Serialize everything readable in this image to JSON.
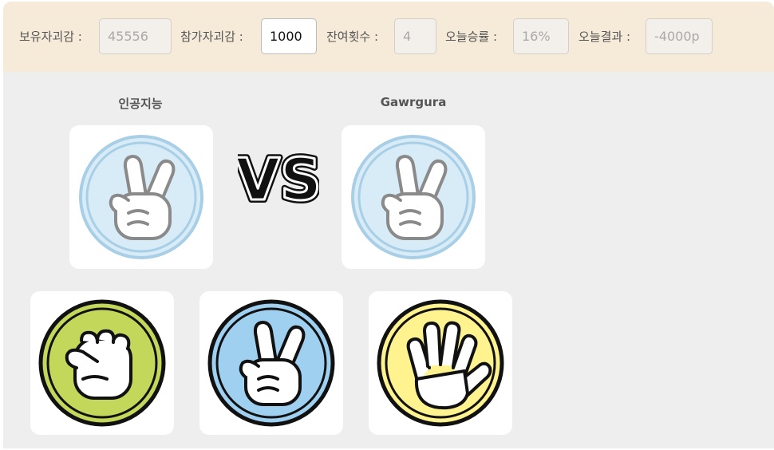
{
  "topbar": {
    "fields": [
      {
        "label": "보유자괴감 :",
        "value": "45556"
      },
      {
        "label": "참가자괴감 :",
        "value": "1000"
      },
      {
        "label": "잔여횟수 :",
        "value": "4"
      },
      {
        "label": "오늘승률 :",
        "value": "16%"
      },
      {
        "label": "오늘결과 :",
        "value": "-4000p"
      }
    ]
  },
  "match": {
    "player_left": "인공지능",
    "player_right": "Gawrgura",
    "vs_text": "VS",
    "left_choice_icon": "scissors-hand-icon",
    "right_choice_icon": "scissors-hand-icon"
  },
  "choices": [
    {
      "icon": "rock-fist-icon",
      "color": "#c3d85a"
    },
    {
      "icon": "scissors-hand-icon",
      "color": "#9fd0f0"
    },
    {
      "icon": "paper-hand-icon",
      "color": "#fff38f"
    }
  ],
  "colors": {
    "topbar_bg": "#f6ead9",
    "panel_bg": "#eeeeee",
    "result_coin_bg": "#d8ecf8",
    "result_coin_ring": "#a9cfe6"
  }
}
